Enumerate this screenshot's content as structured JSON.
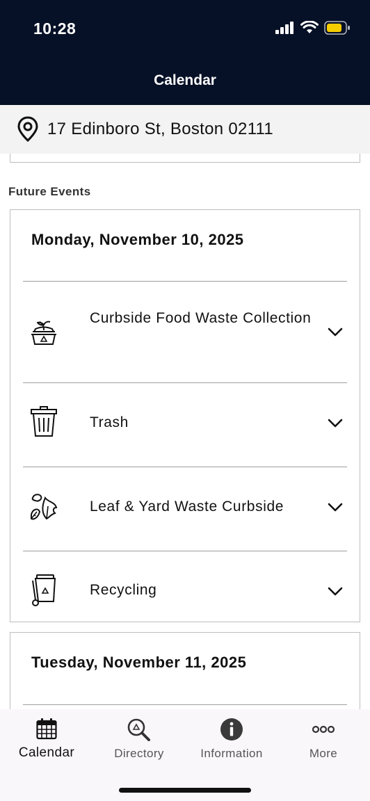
{
  "status_bar": {
    "time": "10:28"
  },
  "header": {
    "title": "Calendar"
  },
  "address": {
    "text": "17 Edinboro St, Boston 02111"
  },
  "section": {
    "label": "Future Events"
  },
  "days": [
    {
      "date": "Monday, November 10, 2025",
      "events": [
        {
          "label": "Curbside Food Waste Collection",
          "icon": "food-waste-bin-icon"
        },
        {
          "label": "Trash",
          "icon": "trash-can-icon"
        },
        {
          "label": "Leaf & Yard Waste Curbside",
          "icon": "leaf-icon"
        },
        {
          "label": "Recycling",
          "icon": "recycling-cart-icon"
        }
      ]
    },
    {
      "date": "Tuesday, November 11, 2025",
      "events": []
    }
  ],
  "tabs": [
    {
      "label": "Calendar",
      "icon": "calendar-icon",
      "active": true
    },
    {
      "label": "Directory",
      "icon": "search-recycle-icon",
      "active": false
    },
    {
      "label": "Information",
      "icon": "info-icon",
      "active": false
    },
    {
      "label": "More",
      "icon": "more-dots-icon",
      "active": false
    }
  ],
  "colors": {
    "header_bg": "#061026",
    "battery": "#f5cc00"
  }
}
